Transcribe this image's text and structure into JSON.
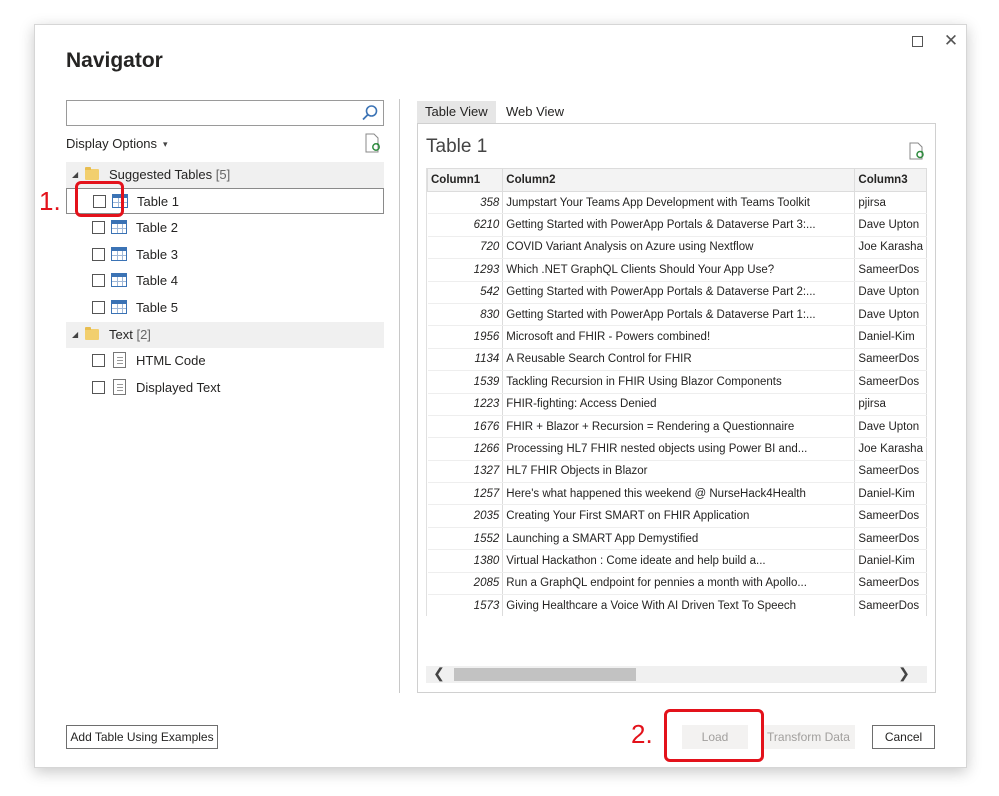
{
  "window": {
    "title": "Navigator",
    "maximize_icon": "maximize-icon",
    "close_icon": "close-icon",
    "close_glyph": "✕"
  },
  "search": {
    "value": "",
    "placeholder": ""
  },
  "display_options": {
    "label": "Display Options",
    "caret": "▾"
  },
  "tree": {
    "groups": [
      {
        "label": "Suggested Tables",
        "count": "[5]",
        "expanded": true,
        "items": [
          {
            "label": "Table 1",
            "checked": false,
            "selected": true,
            "icon": "table-icon"
          },
          {
            "label": "Table 2",
            "checked": false,
            "icon": "table-icon"
          },
          {
            "label": "Table 3",
            "checked": false,
            "icon": "table-icon"
          },
          {
            "label": "Table 4",
            "checked": false,
            "icon": "table-icon"
          },
          {
            "label": "Table 5",
            "checked": false,
            "icon": "table-icon"
          }
        ]
      },
      {
        "label": "Text",
        "count": "[2]",
        "expanded": true,
        "items": [
          {
            "label": "HTML Code",
            "checked": false,
            "icon": "document-icon"
          },
          {
            "label": "Displayed Text",
            "checked": false,
            "icon": "document-icon"
          }
        ]
      }
    ]
  },
  "tabs": [
    {
      "label": "Table View",
      "active": true
    },
    {
      "label": "Web View",
      "active": false
    }
  ],
  "preview": {
    "title": "Table 1",
    "columns": [
      "Column1",
      "Column2",
      "Column3"
    ],
    "rows": [
      [
        "358",
        "Jumpstart Your Teams App Development with Teams Toolkit",
        "pjirsa"
      ],
      [
        "6210",
        "Getting Started with PowerApp Portals & Dataverse Part 3:...",
        "Dave Upton"
      ],
      [
        "720",
        "COVID Variant Analysis on Azure using Nextflow",
        "Joe Karasha"
      ],
      [
        "1293",
        "Which .NET GraphQL Clients Should Your App Use?",
        "SameerDos"
      ],
      [
        "542",
        "Getting Started with PowerApp Portals & Dataverse Part 2:...",
        "Dave Upton"
      ],
      [
        "830",
        "Getting Started with PowerApp Portals & Dataverse Part 1:...",
        "Dave Upton"
      ],
      [
        "1956",
        "Microsoft and FHIR - Powers combined!",
        "Daniel-Kim"
      ],
      [
        "1134",
        "A Reusable Search Control for FHIR",
        "SameerDos"
      ],
      [
        "1539",
        "Tackling Recursion in FHIR Using Blazor Components",
        "SameerDos"
      ],
      [
        "1223",
        "FHIR-fighting: Access Denied",
        "pjirsa"
      ],
      [
        "1676",
        "FHIR + Blazor + Recursion = Rendering a Questionnaire",
        "Dave Upton"
      ],
      [
        "1266",
        "Processing HL7 FHIR nested objects using Power BI and...",
        "Joe Karasha"
      ],
      [
        "1327",
        "HL7 FHIR Objects in Blazor",
        "SameerDos"
      ],
      [
        "1257",
        "Here's what happened this weekend @ NurseHack4Health",
        "Daniel-Kim"
      ],
      [
        "2035",
        "Creating Your First SMART on FHIR Application",
        "SameerDos"
      ],
      [
        "1552",
        "Launching a SMART App Demystified",
        "SameerDos"
      ],
      [
        "1380",
        "Virtual Hackathon : Come ideate and help build a...",
        "Daniel-Kim"
      ],
      [
        "2085",
        "Run a GraphQL endpoint for pennies a month with Apollo...",
        "SameerDos"
      ],
      [
        "1573",
        "Giving Healthcare a Voice With AI Driven Text To Speech",
        "SameerDos"
      ]
    ],
    "scroll_left": "❮",
    "scroll_right": "❯"
  },
  "buttons": {
    "add_table": "Add Table Using Examples",
    "load": "Load",
    "transform": "Transform Data",
    "cancel": "Cancel"
  },
  "annotations": {
    "step1": "1.",
    "step2": "2.",
    "color": "#e3121b"
  },
  "colors": {
    "accent": "#3b73b5",
    "folder": "#f2cf6e",
    "disabled_text": "#a19f9d"
  }
}
